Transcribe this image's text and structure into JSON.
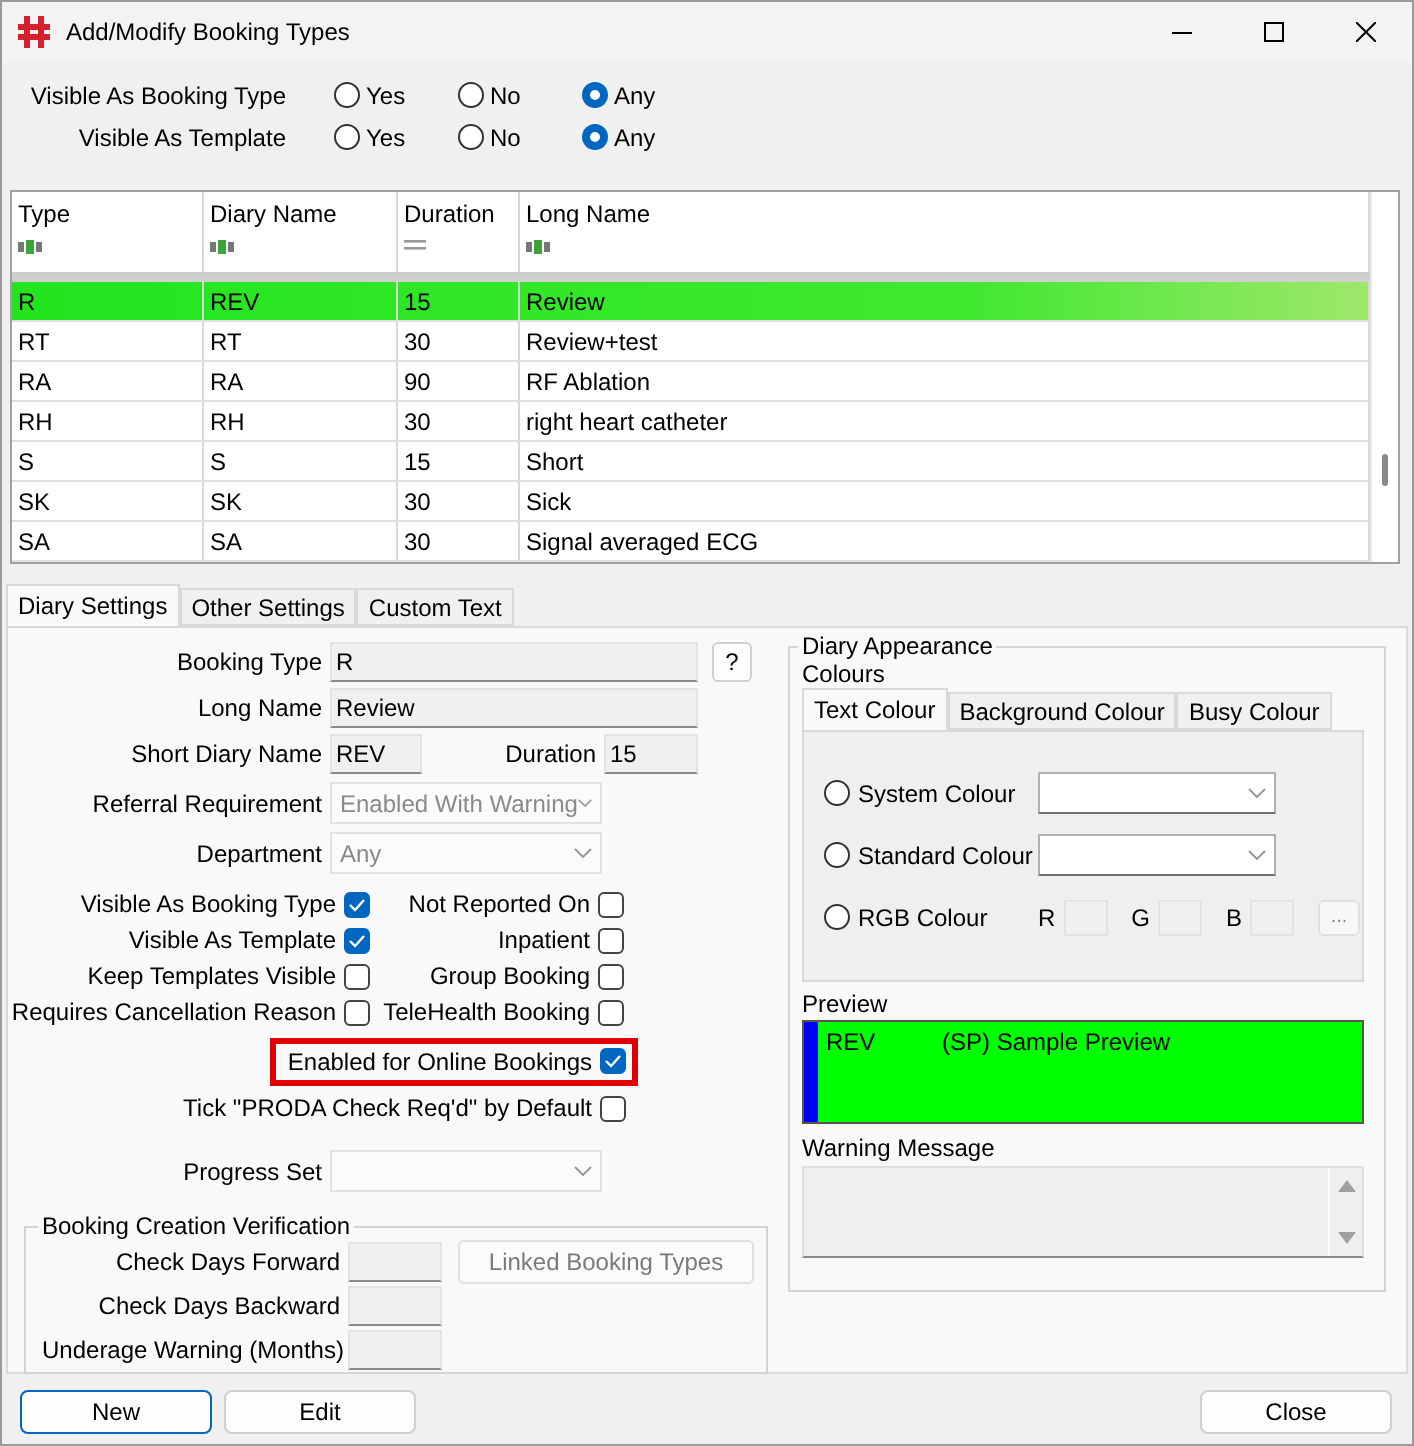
{
  "window": {
    "title": "Add/Modify Booking Types"
  },
  "filters": [
    {
      "label": "Visible As Booking Type",
      "options": [
        {
          "label": "Yes",
          "selected": false
        },
        {
          "label": "No",
          "selected": false
        },
        {
          "label": "Any",
          "selected": true
        }
      ]
    },
    {
      "label": "Visible As Template",
      "options": [
        {
          "label": "Yes",
          "selected": false
        },
        {
          "label": "No",
          "selected": false
        },
        {
          "label": "Any",
          "selected": true
        }
      ]
    }
  ],
  "table": {
    "columns": [
      {
        "label": "Type",
        "kind": "text"
      },
      {
        "label": "Diary Name",
        "kind": "text"
      },
      {
        "label": "Duration",
        "kind": "number"
      },
      {
        "label": "Long Name",
        "kind": "text"
      }
    ],
    "rows": [
      {
        "cells": [
          "R",
          "REV",
          "15",
          "Review"
        ],
        "selected": true
      },
      {
        "cells": [
          "RT",
          "RT",
          "30",
          "Review+test"
        ],
        "selected": false
      },
      {
        "cells": [
          "RA",
          "RA",
          "90",
          "RF Ablation"
        ],
        "selected": false
      },
      {
        "cells": [
          "RH",
          "RH",
          "30",
          "right heart catheter"
        ],
        "selected": false
      },
      {
        "cells": [
          "S",
          "S",
          "15",
          "Short"
        ],
        "selected": false
      },
      {
        "cells": [
          "SK",
          "SK",
          "30",
          "Sick"
        ],
        "selected": false
      },
      {
        "cells": [
          "SA",
          "SA",
          "30",
          "Signal averaged ECG"
        ],
        "selected": false
      }
    ]
  },
  "tabs": [
    {
      "label": "Diary Settings",
      "selected": true
    },
    {
      "label": "Other Settings",
      "selected": false
    },
    {
      "label": "Custom Text",
      "selected": false
    }
  ],
  "settings": {
    "booking_type": {
      "label": "Booking Type",
      "value": "R"
    },
    "help_button": "?",
    "long_name": {
      "label": "Long Name",
      "value": "Review"
    },
    "short_diary_name": {
      "label": "Short Diary Name",
      "value": "REV"
    },
    "duration": {
      "label": "Duration",
      "value": "15"
    },
    "referral_requirement": {
      "label": "Referral Requirement",
      "value": "Enabled With Warning",
      "disabled": true
    },
    "department": {
      "label": "Department",
      "value": "Any",
      "disabled": true
    },
    "check_rows": [
      {
        "left": {
          "label": "Visible As Booking Type",
          "checked": true
        },
        "right": {
          "label": "Not Reported On",
          "checked": false
        }
      },
      {
        "left": {
          "label": "Visible As Template",
          "checked": true
        },
        "right": {
          "label": "Inpatient",
          "checked": false
        }
      },
      {
        "left": {
          "label": "Keep Templates Visible",
          "checked": false
        },
        "right": {
          "label": "Group Booking",
          "checked": false
        }
      },
      {
        "left": {
          "label": "Requires Cancellation Reason",
          "checked": false
        },
        "right": {
          "label": "TeleHealth Booking",
          "checked": false
        }
      }
    ],
    "extra_checks": [
      {
        "label": "Enabled for Online Bookings",
        "checked": true,
        "highlighted": true
      },
      {
        "label": "Tick \"PRODA Check Req'd\" by Default",
        "checked": false,
        "highlighted": false
      }
    ],
    "progress_set": {
      "label": "Progress Set",
      "disabled": true
    }
  },
  "verification": {
    "title": "Booking Creation Verification",
    "fields": [
      {
        "label": "Check Days Forward"
      },
      {
        "label": "Check Days Backward"
      },
      {
        "label": "Underage Warning (Months)"
      }
    ],
    "linked_button": "Linked Booking Types"
  },
  "appearance": {
    "title": "Diary Appearance",
    "colours_label": "Colours",
    "tabs": [
      {
        "label": "Text Colour",
        "selected": true
      },
      {
        "label": "Background Colour",
        "selected": false
      },
      {
        "label": "Busy Colour",
        "selected": false
      }
    ],
    "options": [
      {
        "label": "System Colour",
        "kind": "select",
        "selected": false
      },
      {
        "label": "Standard Colour",
        "kind": "select",
        "selected": false
      },
      {
        "label": "RGB Colour",
        "kind": "rgb",
        "selected": false
      }
    ],
    "rgb_labels": [
      "R",
      "G",
      "B"
    ],
    "rgb_button": "...",
    "preview_label": "Preview",
    "preview": {
      "short_name": "REV",
      "text": "(SP) Sample Preview",
      "color": "#00ff00",
      "marker": {
        "color": "#0000ff"
      }
    },
    "warning_label": "Warning Message"
  },
  "buttons": [
    {
      "label": "New",
      "kind": "default"
    },
    {
      "label": "Edit",
      "kind": "normal"
    },
    {
      "label": "Close",
      "kind": "close"
    }
  ]
}
